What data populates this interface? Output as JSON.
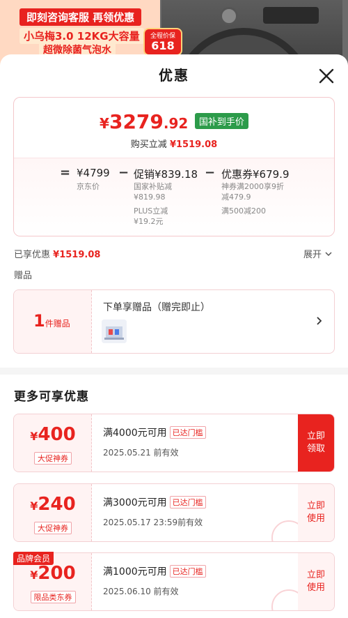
{
  "banner": {
    "line1": "即刻咨询客服 再领优惠",
    "line2": "小乌梅3.0 12KG大容量",
    "line3": "超微除菌气泡水",
    "badge_small": "全程价保",
    "badge_big": "618"
  },
  "sheet": {
    "title": "优惠"
  },
  "price": {
    "currency": "¥",
    "integer": "3279",
    "decimal": ".92",
    "subsidy_tag": "国补到手价",
    "instant_cut_label": "购买立减",
    "instant_cut_amount": "¥1519.08"
  },
  "breakdown": {
    "eq": "=",
    "minus": "−",
    "jd_price": "¥4799",
    "jd_price_label": "京东价",
    "promo": "促销¥839.18",
    "promo_sub1": "国家补贴减",
    "promo_sub1_val": "¥819.98",
    "promo_sub2": "PLUS立减",
    "promo_sub2_val": "¥19.2元",
    "coupon": "优惠券¥679.9",
    "coupon_sub1": "神券满2000享9折",
    "coupon_sub1_val": "减479.9",
    "coupon_sub2": "满500减200"
  },
  "enjoyed": {
    "label": "已享优惠",
    "amount": "¥1519.08",
    "expand": "展开"
  },
  "gifts": {
    "label": "赠品",
    "count": "1",
    "count_unit": "件赠品",
    "title": "下单享赠品（赠完即止）"
  },
  "more": {
    "title": "更多可享优惠"
  },
  "coupons": [
    {
      "currency": "¥",
      "amount": "400",
      "type": "大促神券",
      "condition": "满4000元可用",
      "met": "已达门槛",
      "expiry": "2025.05.21 前有效",
      "action_l1": "立即",
      "action_l2": "领取"
    },
    {
      "currency": "¥",
      "amount": "240",
      "type": "大促神券",
      "condition": "满3000元可用",
      "met": "已达门槛",
      "expiry": "2025.05.17  23:59前有效",
      "action_l1": "立即",
      "action_l2": "使用"
    },
    {
      "currency": "¥",
      "amount": "200",
      "type": "限品类东券",
      "condition": "满1000元可用",
      "met": "已达门槛",
      "expiry": "2025.06.10 前有效",
      "action_l1": "立即",
      "action_l2": "使用",
      "member_tag": "品牌会员"
    }
  ],
  "colors": {
    "accent": "#e8231f",
    "subsidy": "#2c9b4a"
  }
}
